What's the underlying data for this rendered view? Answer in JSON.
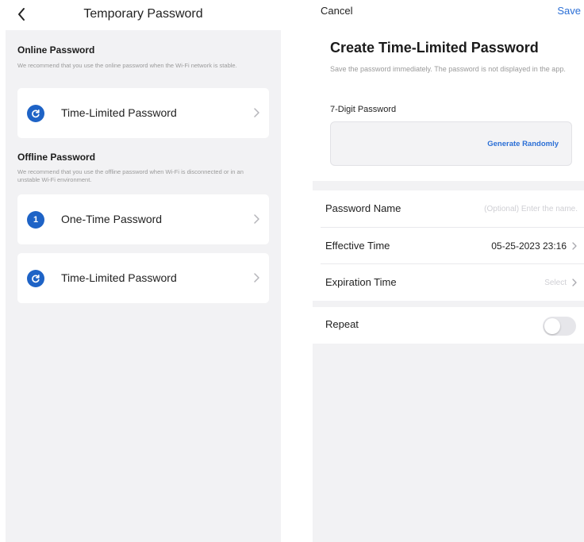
{
  "left": {
    "title": "Temporary Password",
    "online": {
      "title": "Online Password",
      "description": "We recommend that you use the online password when the Wi-Fi network is stable.",
      "items": [
        {
          "label": "Time-Limited Password",
          "icon": "refresh-icon",
          "badge": ""
        }
      ]
    },
    "offline": {
      "title": "Offline Password",
      "description": "We recommend that you use the offline password when Wi-Fi is disconnected or in an unstable Wi-Fi environment.",
      "items": [
        {
          "label": "One-Time Password",
          "icon": "one-icon",
          "badge": "1"
        },
        {
          "label": "Time-Limited Password",
          "icon": "refresh-icon",
          "badge": ""
        }
      ]
    }
  },
  "right": {
    "cancel": "Cancel",
    "save": "Save",
    "title": "Create Time-Limited Password",
    "description": "Save the password immediately. The password is not displayed in the app.",
    "digit_label": "7-Digit Password",
    "generate": "Generate Randomly",
    "rows": {
      "name": {
        "label": "Password Name",
        "placeholder": "(Optional) Enter the name."
      },
      "effective": {
        "label": "Effective Time",
        "value": "05-25-2023 23:16"
      },
      "expiration": {
        "label": "Expiration Time",
        "value": "Select"
      },
      "repeat": {
        "label": "Repeat",
        "enabled": false
      }
    }
  },
  "colors": {
    "accent": "#1e63c6",
    "link": "#2b6fd6",
    "background": "#f2f2f4"
  }
}
